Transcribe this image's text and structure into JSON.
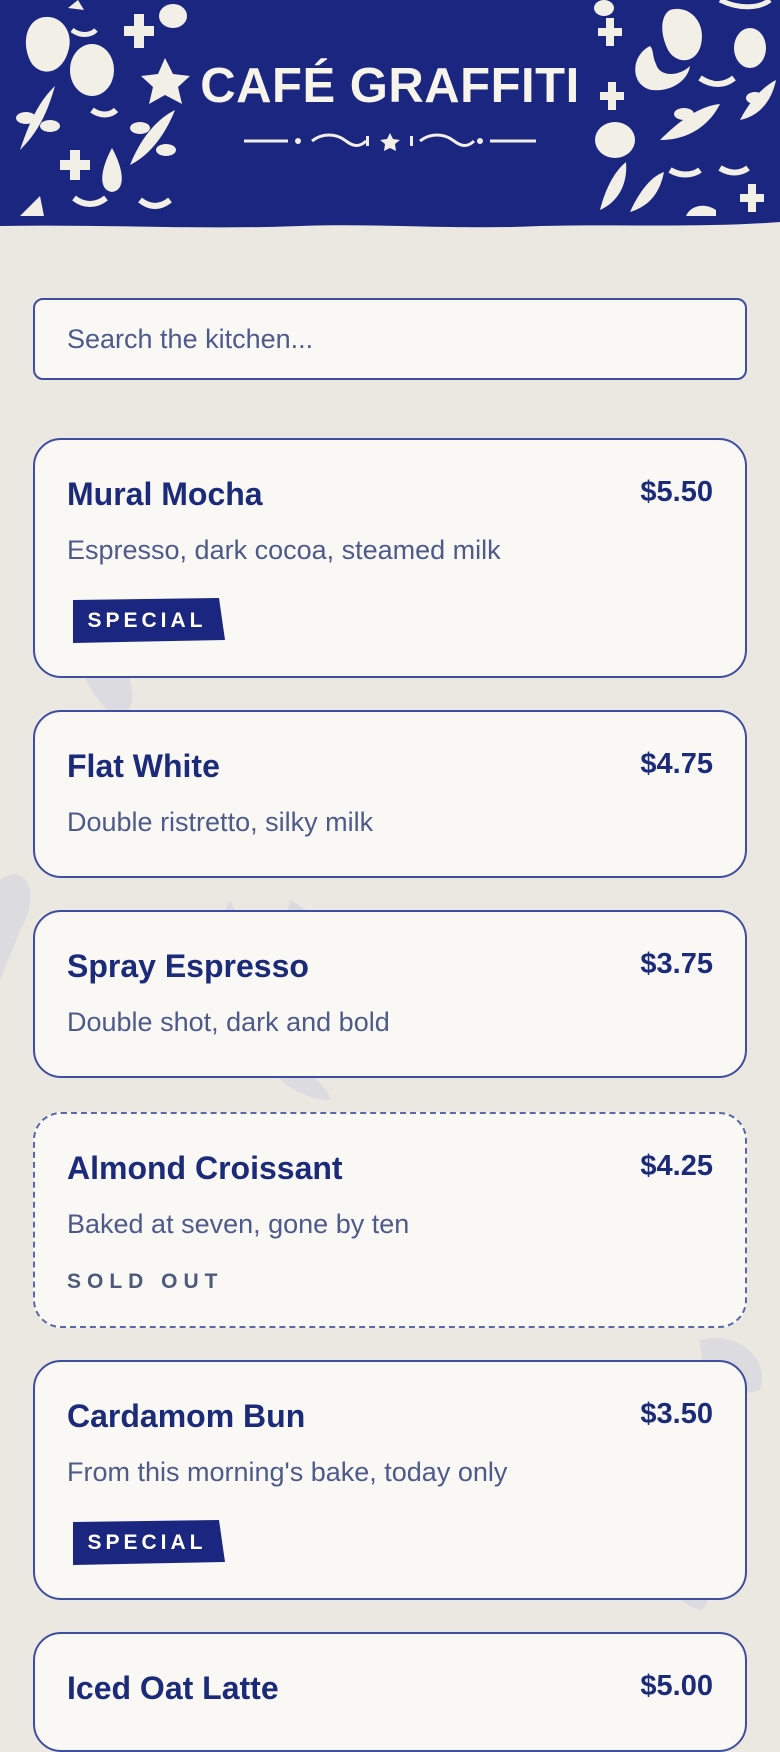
{
  "brand": {
    "title": "CAFÉ GRAFFITI"
  },
  "search": {
    "placeholder": "Search the kitchen..."
  },
  "menu": {
    "items": [
      {
        "name": "Mural Mocha",
        "price": "$5.50",
        "description": "Espresso, dark cocoa, steamed milk",
        "tag": "SPECIAL"
      },
      {
        "name": "Flat White",
        "price": "$4.75",
        "description": "Double ristretto, silky milk"
      },
      {
        "name": "Spray Espresso",
        "price": "$3.75",
        "description": "Double shot, dark and bold"
      },
      {
        "name": "Almond Croissant",
        "price": "$4.25",
        "description": "Baked at seven, gone by ten",
        "status": "SOLD OUT"
      },
      {
        "name": "Cardamom Bun",
        "price": "$3.50",
        "description": "From this morning's bake, today only",
        "tag": "SPECIAL"
      },
      {
        "name": "Iced Oat Latte",
        "price": "$5.00"
      }
    ]
  },
  "colors": {
    "brand_blue": "#1c2a7a",
    "header_bg": "#1b2680",
    "paper": "#ebe8e2",
    "card_bg": "#f9f8f5"
  }
}
